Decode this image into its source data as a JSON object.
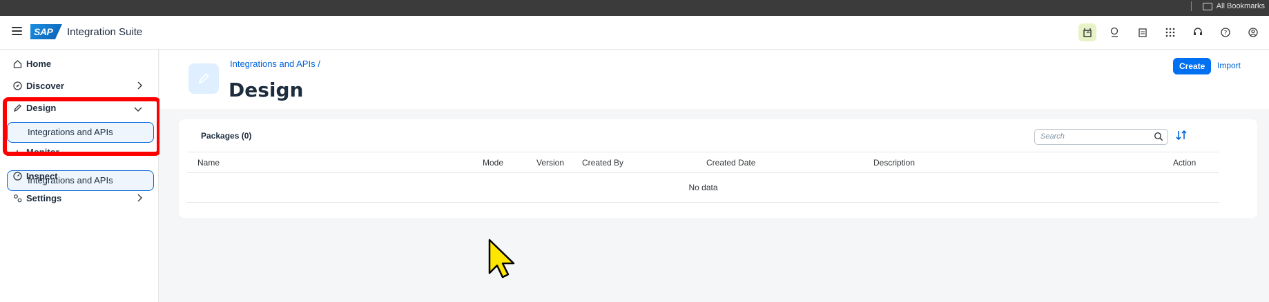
{
  "browser": {
    "bookmarks_label": "All Bookmarks"
  },
  "shell": {
    "logo_text": "SAP",
    "product_name": "Integration Suite",
    "icons": [
      "joule-icon",
      "feedback-icon",
      "notes-icon",
      "grid-icon",
      "support-icon",
      "help-icon",
      "user-icon"
    ]
  },
  "sidebar": {
    "items": [
      {
        "label": "Home",
        "icon": "home-icon"
      },
      {
        "label": "Discover",
        "icon": "compass-icon"
      },
      {
        "label": "Design",
        "icon": "pencil-icon"
      },
      {
        "label": "Monitor",
        "icon": "chart-icon"
      },
      {
        "label": "Inspect",
        "icon": "gauge-icon"
      },
      {
        "label": "Settings",
        "icon": "settings-icon"
      }
    ],
    "sub_item": "Integrations and APIs"
  },
  "page": {
    "breadcrumb": "Integrations and APIs /",
    "title": "Design",
    "create_label": "Create",
    "import_label": "Import"
  },
  "packages": {
    "title": "Packages (0)",
    "search_placeholder": "Search",
    "columns": [
      "Name",
      "Mode",
      "Version",
      "Created By",
      "Created Date",
      "Description",
      "Action"
    ],
    "empty_text": "No data"
  },
  "colors": {
    "accent": "#0070f2",
    "highlight": "#ff0000"
  }
}
